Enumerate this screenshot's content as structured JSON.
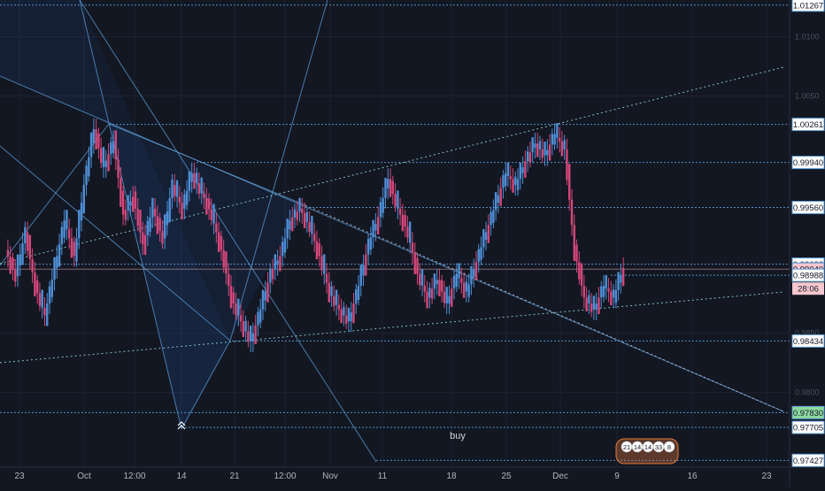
{
  "chart_data": {
    "type": "candlestick",
    "title": "",
    "xlabel": "",
    "ylabel": "",
    "ylim": [
      0.9737,
      1.0131
    ],
    "x_ticks": [
      "23",
      "Oct",
      "12:00",
      "14",
      "21",
      "12:00",
      "Nov",
      "11",
      "18",
      "25",
      "Dec",
      "9",
      "16",
      "23"
    ],
    "y_ticks": [
      1.01,
      1.005,
      0.985,
      0.98
    ],
    "price_labels": [
      {
        "text": "1.01267",
        "value": 1.01267
      },
      {
        "text": "1.00261",
        "value": 1.00261
      },
      {
        "text": "0.99940",
        "value": 0.9994
      },
      {
        "text": "0.99560",
        "value": 0.9956
      },
      {
        "text": "0.99082",
        "value": 0.99082
      },
      {
        "text": "0.99040",
        "value": 0.9904
      },
      {
        "text": "0.98988",
        "value": 0.98988
      },
      {
        "text": "0.98434",
        "value": 0.98434
      },
      {
        "text": "0.97830",
        "value": 0.9783
      },
      {
        "text": "0.97705",
        "value": 0.97705
      },
      {
        "text": "0.97427",
        "value": 0.97427
      }
    ],
    "current_price": 0.9904,
    "countdown": "28:06",
    "annotation_text": "buy",
    "event_badges": [
      "21",
      "14",
      "14",
      "33",
      "8"
    ],
    "colors": {
      "background": "#131722",
      "up": "#4e8fd6",
      "down": "#d4487a",
      "level_line": "#5b9bd5",
      "trend_line": "#7fbfbf",
      "current_price_bg": "#f6c7cf",
      "highlight_price_bg": "#8cd9a0"
    },
    "ohlc_points": [
      [
        0,
        0.992
      ],
      [
        1,
        0.9898
      ],
      [
        2,
        0.9935
      ],
      [
        3,
        0.989
      ],
      [
        4,
        0.9865
      ],
      [
        5,
        0.9905
      ],
      [
        6,
        0.9945
      ],
      [
        7,
        0.9915
      ],
      [
        8,
        0.9975
      ],
      [
        9,
        1.0022
      ],
      [
        10,
        0.999
      ],
      [
        11,
        1.0012
      ],
      [
        12,
        0.995
      ],
      [
        13,
        0.9965
      ],
      [
        14,
        0.9925
      ],
      [
        15,
        0.9955
      ],
      [
        16,
        0.993
      ],
      [
        17,
        0.9975
      ],
      [
        18,
        0.9955
      ],
      [
        19,
        0.9985
      ],
      [
        20,
        0.9968
      ],
      [
        21,
        0.995
      ],
      [
        22,
        0.992
      ],
      [
        23,
        0.988
      ],
      [
        24,
        0.986
      ],
      [
        25,
        0.9843
      ],
      [
        26,
        0.987
      ],
      [
        27,
        0.99
      ],
      [
        28,
        0.9915
      ],
      [
        29,
        0.9945
      ],
      [
        30,
        0.9955
      ],
      [
        31,
        0.994
      ],
      [
        32,
        0.9915
      ],
      [
        33,
        0.9885
      ],
      [
        34,
        0.987
      ],
      [
        35,
        0.986
      ],
      [
        36,
        0.989
      ],
      [
        37,
        0.9925
      ],
      [
        38,
        0.9948
      ],
      [
        39,
        0.998
      ],
      [
        40,
        0.9955
      ],
      [
        41,
        0.9935
      ],
      [
        42,
        0.99
      ],
      [
        43,
        0.988
      ],
      [
        44,
        0.9895
      ],
      [
        45,
        0.9875
      ],
      [
        46,
        0.99
      ],
      [
        47,
        0.9885
      ],
      [
        48,
        0.991
      ],
      [
        49,
        0.9935
      ],
      [
        50,
        0.996
      ],
      [
        51,
        0.9985
      ],
      [
        52,
        0.9975
      ],
      [
        53,
        0.9995
      ],
      [
        54,
        1.001
      ],
      [
        55,
        1.0
      ],
      [
        56,
        1.0018
      ],
      [
        57,
        1.0005
      ],
      [
        58,
        0.992
      ],
      [
        59,
        0.988
      ],
      [
        60,
        0.987
      ],
      [
        61,
        0.989
      ],
      [
        62,
        0.988
      ],
      [
        63,
        0.9905
      ]
    ]
  }
}
